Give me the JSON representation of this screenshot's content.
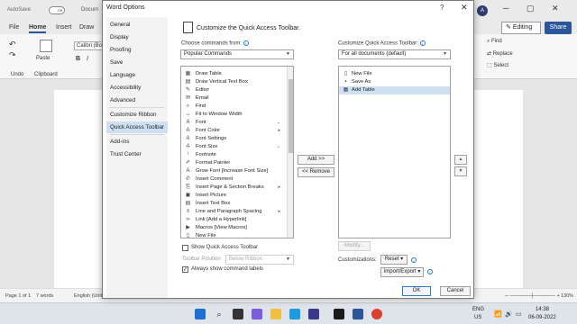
{
  "word": {
    "autosave_label": "AutoSave",
    "autosave_state": "Off",
    "doc_title": "Docum",
    "avatar_initial": "A",
    "tabs": [
      "File",
      "Home",
      "Insert",
      "Draw"
    ],
    "editing_label": "Editing",
    "share_label": "Share",
    "ribbon": {
      "paste": "Paste",
      "font_name": "Calibri (Body",
      "undo": "Undo",
      "clipboard": "Clipboard",
      "find": "Find",
      "replace": "Replace",
      "select": "Select"
    },
    "status": {
      "page": "Page 1 of 1",
      "words": "7 words",
      "language": "English (United",
      "zoom": "130%"
    },
    "taskbar": {
      "lang": "ENG",
      "region": "US",
      "time": "14:38",
      "date": "06-09-2022"
    }
  },
  "dialog": {
    "title": "Word Options",
    "help": "?",
    "close": "✕",
    "nav": [
      "General",
      "Display",
      "Proofing",
      "Save",
      "Language",
      "Accessibility",
      "Advanced",
      "Customize Ribbon",
      "Quick Access Toolbar",
      "Add-ins",
      "Trust Center"
    ],
    "nav_active": "Quick Access Toolbar",
    "heading": "Customize the Quick Access Toolbar.",
    "choose_label": "Choose commands from:",
    "choose_value": "Popular Commands",
    "customize_label": "Customize Quick Access Toolbar:",
    "customize_value": "For all documents (default)",
    "commands": [
      {
        "label": "Draw Table",
        "icon": "table-icon"
      },
      {
        "label": "Draw Vertical Text Box",
        "icon": "textbox-icon"
      },
      {
        "label": "Editor",
        "icon": "editor-icon"
      },
      {
        "label": "Email",
        "icon": "email-icon"
      },
      {
        "label": "Find",
        "icon": "find-icon"
      },
      {
        "label": "Fit to Window Width",
        "icon": "fit-width-icon"
      },
      {
        "label": "Font",
        "icon": "font-icon"
      },
      {
        "label": "Font Color",
        "icon": "font-color-icon"
      },
      {
        "label": "Font Settings",
        "icon": "font-settings-icon"
      },
      {
        "label": "Font Size",
        "icon": "font-size-icon"
      },
      {
        "label": "Footnote",
        "icon": "footnote-icon"
      },
      {
        "label": "Format Painter",
        "icon": "format-painter-icon"
      },
      {
        "label": "Grow Font [Increase Font Size]",
        "icon": "grow-font-icon"
      },
      {
        "label": "Insert Comment",
        "icon": "comment-icon"
      },
      {
        "label": "Insert Page & Section Breaks",
        "icon": "page-break-icon"
      },
      {
        "label": "Insert Picture",
        "icon": "picture-icon"
      },
      {
        "label": "Insert Text Box",
        "icon": "textbox-icon"
      },
      {
        "label": "Line and Paragraph Spacing",
        "icon": "line-spacing-icon"
      },
      {
        "label": "Link [Add a Hyperlink]",
        "icon": "link-icon"
      },
      {
        "label": "Macros [View Macros]",
        "icon": "macros-icon"
      },
      {
        "label": "New File",
        "icon": "new-file-icon"
      }
    ],
    "add_label": "Add >>",
    "remove_label": "<< Remove",
    "qat_items": [
      {
        "label": "New File",
        "icon": "new-file-icon"
      },
      {
        "label": "Save As",
        "icon": "save-icon"
      },
      {
        "label": "Add Table",
        "icon": "table-icon"
      }
    ],
    "qat_selected": "Add Table",
    "modify_label": "Modify...",
    "show_qat_label": "Show Quick Access Toolbar",
    "toolbar_position_label": "Toolbar Position",
    "toolbar_position_value": "Below Ribbon",
    "always_show_labels": "Always show command labels",
    "customizations_label": "Customizations:",
    "reset_label": "Reset",
    "import_export_label": "Import/Export",
    "ok_label": "OK",
    "cancel_label": "Cancel"
  }
}
